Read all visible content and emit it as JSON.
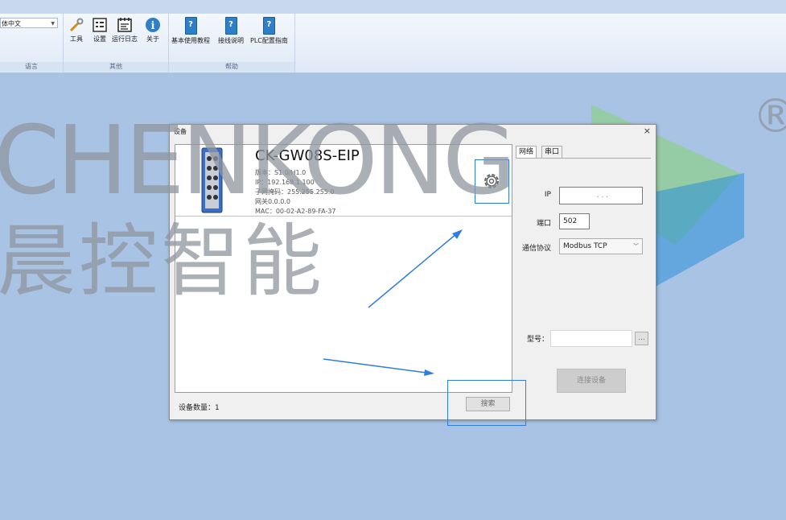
{
  "ribbon": {
    "language": {
      "value": "体中文",
      "group_label": "语言"
    },
    "other": {
      "group_label": "其他",
      "buttons": [
        {
          "label": "工具",
          "icon": "tools-icon"
        },
        {
          "label": "设置",
          "icon": "settings-icon"
        },
        {
          "label": "运行日志",
          "icon": "log-icon"
        },
        {
          "label": "关于",
          "icon": "info-icon"
        }
      ]
    },
    "help": {
      "group_label": "帮助",
      "buttons": [
        {
          "label": "基本使用教程",
          "icon": "help-book-icon"
        },
        {
          "label": "接线说明",
          "icon": "help-book-icon"
        },
        {
          "label": "PLC配置指南",
          "icon": "help-book-icon"
        }
      ]
    }
  },
  "watermark": {
    "latin": "CHENKONG",
    "chinese": "晨控智能",
    "mark": "®"
  },
  "dialog": {
    "title": "设备",
    "close": "×",
    "device": {
      "name": "CK-GW08S-EIP",
      "version": "版本：S1.0/H1.0",
      "ip": "IP：192.168.1.100",
      "subnet": "子网掩码：255.255.255.0",
      "gateway": "网关0.0.0.0",
      "mac": "MAC：00-02-A2-89-FA-37"
    },
    "device_count_label": "设备数量：1",
    "search_button": "搜索",
    "tabs": [
      "网络",
      "串口"
    ],
    "form": {
      "ip_label": "IP",
      "ip_value": ".     .     .",
      "port_label": "端口",
      "port_value": "502",
      "protocol_label": "通信协议",
      "protocol_value": "Modbus TCP",
      "model_label": "型号：",
      "model_value": "",
      "browse_button": "...",
      "connect_button": "连接设备"
    }
  },
  "colors": {
    "accent_blue": "#2e7de0",
    "desktop": "#a9c3e4",
    "watermark_green": "#8fd08a",
    "watermark_blue": "#2a8fd8"
  }
}
